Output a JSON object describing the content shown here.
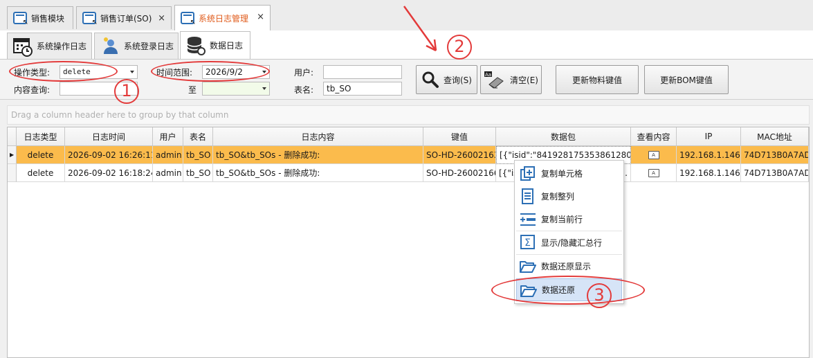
{
  "doc_tabs": [
    {
      "label": "销售模块"
    },
    {
      "label": "销售订单(SO)",
      "close": "×"
    },
    {
      "label": "系统日志管理",
      "close": "×"
    }
  ],
  "sub_tabs": [
    {
      "label": "系统操作日志"
    },
    {
      "label": "系统登录日志"
    },
    {
      "label": "数据日志"
    }
  ],
  "filter": {
    "op_type_label": "操作类型:",
    "op_type_value": "delete",
    "content_label": "内容查询:",
    "content_value": "",
    "time_label": "时间范围:",
    "time_from": "2026/9/2",
    "to_label": "至",
    "time_to": "",
    "user_label": "用户:",
    "user_value": "",
    "table_label": "表名:",
    "table_value": "tb_SO"
  },
  "buttons": {
    "query": "查询(S)",
    "clear": "清空(E)",
    "update_material": "更新物料键值",
    "update_bom": "更新BOM键值"
  },
  "group_hint": "Drag a column header here to group by that column",
  "columns": [
    "日志类型",
    "日志时间",
    "用户",
    "表名",
    "日志内容",
    "键值",
    "数据包",
    "查看内容",
    "IP",
    "MAC地址"
  ],
  "rows": [
    {
      "type": "delete",
      "time": "2026-09-02 16:26:11",
      "user": "admin",
      "table": "tb_SO",
      "content": "tb_SO&tb_SOs - 删除成功:",
      "key": "SO-HD-26002163",
      "pkg": "[{\"isid\":\"8419281753538612808...",
      "ip": "192.168.1.146",
      "mac": "74D713B0A7AD"
    },
    {
      "type": "delete",
      "time": "2026-09-02 16:18:24",
      "user": "admin",
      "table": "tb_SO",
      "content": "tb_SO&tb_SOs - 删除成功:",
      "key": "SO-HD-26002166",
      "pkg": "[{\"isi",
      "pkg_tail": "..",
      "ip": "192.168.1.146",
      "mac": "74D713B0A7AD"
    }
  ],
  "context_menu": [
    {
      "label": "复制单元格",
      "icon": "copy-cell-icon"
    },
    {
      "label": "复制整列",
      "icon": "copy-column-icon"
    },
    {
      "label": "复制当前行",
      "icon": "copy-row-icon"
    },
    {
      "label": "显示/隐藏汇总行",
      "icon": "sigma-icon"
    },
    {
      "label": "数据还原显示",
      "icon": "folder-open-icon"
    },
    {
      "label": "数据还原",
      "icon": "folder-open-icon"
    }
  ],
  "annotations": {
    "n1": "1",
    "n2": "2",
    "n3": "3",
    "color": "#e33a3a"
  },
  "colors": {
    "selected_row": "#fbbb4c",
    "active_tab_text": "#e05a1a",
    "accent_blue": "#2c6fb5"
  }
}
